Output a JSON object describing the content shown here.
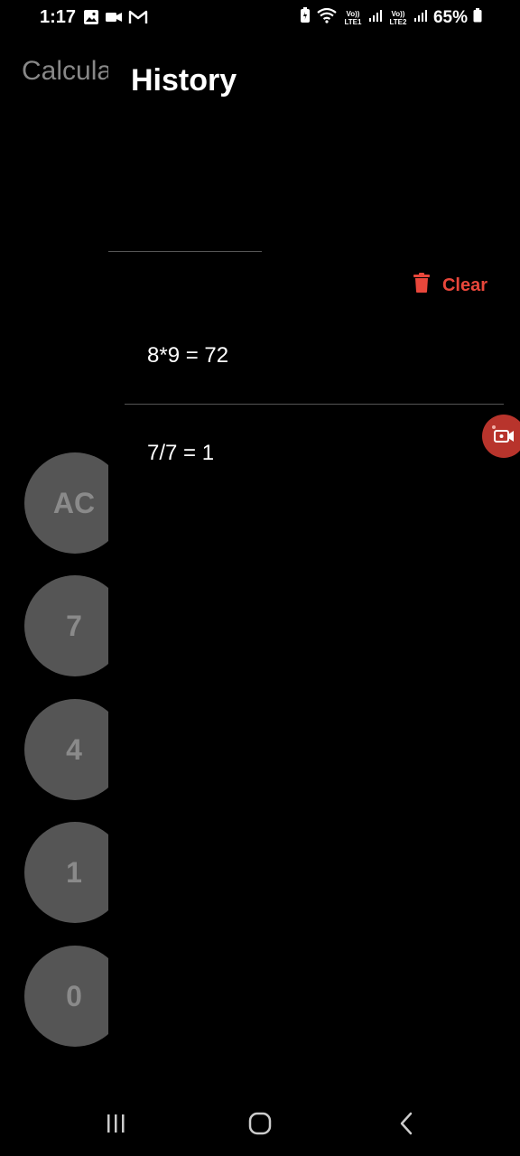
{
  "status_bar": {
    "time": "1:17",
    "battery": "65%",
    "sim1": "Vo)) LTE1",
    "sim2": "Vo)) LTE2",
    "left_icons": [
      "image-icon",
      "video-icon",
      "gmail-icon"
    ],
    "right_icons": [
      "battery-saver-icon",
      "wifi-icon",
      "signal-icon",
      "signal-icon",
      "battery-icon"
    ]
  },
  "background_app": {
    "title": "Calcula",
    "buttons": [
      "AC",
      "7",
      "4",
      "1",
      "0"
    ]
  },
  "drawer": {
    "title": "History",
    "clear_label": "Clear",
    "items": [
      {
        "text": "8*9 = 72"
      },
      {
        "text": "7/7 = 1"
      }
    ]
  },
  "colors": {
    "accent": "#e9473b",
    "button_bg": "#555555",
    "background": "#000000",
    "float_record": "#b8342c"
  },
  "nav_bar": {
    "icons": [
      "recents-icon",
      "home-icon",
      "back-icon"
    ]
  }
}
